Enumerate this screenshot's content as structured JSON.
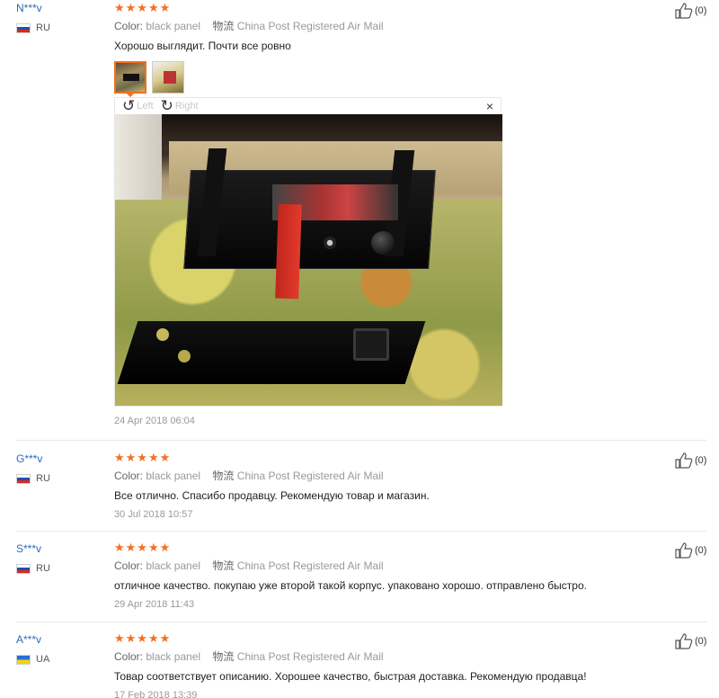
{
  "labels": {
    "color_label": "Color:",
    "shipping_label": "物流",
    "rotate_left": "Left",
    "rotate_right": "Right",
    "close_glyph": "×"
  },
  "icons": {
    "star": "star-icon",
    "flag": "flag-icon",
    "thumbs_up": "thumbs-up-icon",
    "rotate_left": "rotate-left-icon",
    "rotate_right": "rotate-right-icon",
    "close": "close-icon"
  },
  "colors": {
    "accent": "#f36f21",
    "username": "#2a6bb8",
    "muted_text": "#999999"
  },
  "reviews": [
    {
      "user": "N***v",
      "country": "RU",
      "rating": 5,
      "stars": "★★★★★",
      "color": "black panel",
      "shipping": "China Post Registered Air Mail",
      "feedback": "Хорошо выглядит. Почти все ровно",
      "date": "24 Apr 2018 06:04",
      "likes": "(0)"
    },
    {
      "user": "G***v",
      "country": "RU",
      "rating": 5,
      "stars": "★★★★★",
      "color": "black panel",
      "shipping": "China Post Registered Air Mail",
      "feedback": "Все отлично. Спасибо продавцу. Рекомендую товар и магазин.",
      "date": "30 Jul 2018 10:57",
      "likes": "(0)"
    },
    {
      "user": "S***v",
      "country": "RU",
      "rating": 5,
      "stars": "★★★★★",
      "color": "black panel",
      "shipping": "China Post Registered Air Mail",
      "feedback": "отличное качество. покупаю уже второй такой корпус. упаковано хорошо. отправлено быстро.",
      "date": "29 Apr 2018 11:43",
      "likes": "(0)"
    },
    {
      "user": "A***v",
      "country": "UA",
      "rating": 5,
      "stars": "★★★★★",
      "color": "black panel",
      "shipping": "China Post Registered Air Mail",
      "feedback": "Товар соответствует описанию. Хорошее качество, быстрая доставка. Рекомендую продавца!",
      "date": "17 Feb 2018 13:39",
      "likes": "(0)"
    }
  ]
}
